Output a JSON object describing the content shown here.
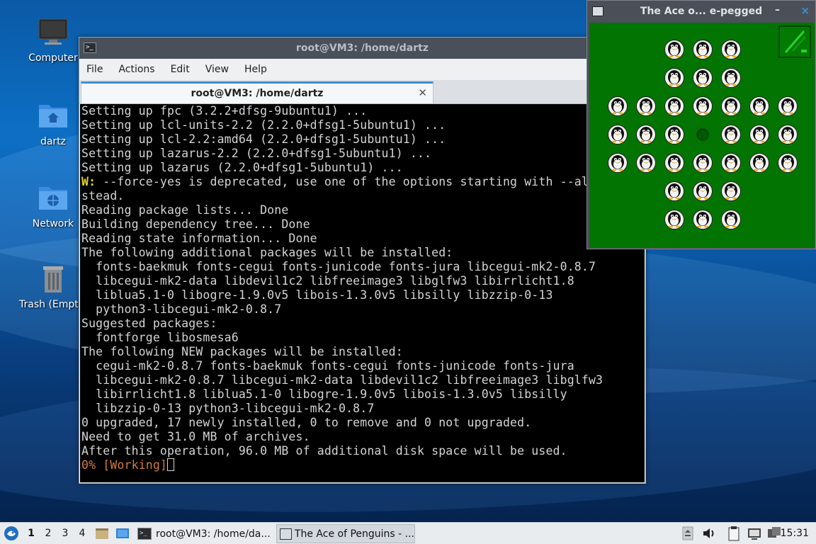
{
  "desktop": {
    "icons": [
      {
        "label": "Computer"
      },
      {
        "label": "dartz"
      },
      {
        "label": "Network"
      },
      {
        "label": "Trash (Empty)"
      }
    ]
  },
  "terminal": {
    "window_title": "root@VM3: /home/dartz",
    "menu": [
      "File",
      "Actions",
      "Edit",
      "View",
      "Help"
    ],
    "tab_title": "root@VM3: /home/dartz",
    "lines": [
      "Setting up fpc (3.2.2+dfsg-9ubuntu1) ...",
      "Setting up lcl-units-2.2 (2.2.0+dfsg1-5ubuntu1) ...",
      "Setting up lcl-2.2:amd64 (2.2.0+dfsg1-5ubuntu1) ...",
      "Setting up lazarus-2.2 (2.2.0+dfsg1-5ubuntu1) ...",
      "Setting up lazarus (2.2.0+dfsg1-5ubuntu1) ..."
    ],
    "warn_prefix": "W:",
    "warn_text": " --force-yes is deprecated, use one of the options starting with --all",
    "lines2": [
      "stead.",
      "Reading package lists... Done",
      "Building dependency tree... Done",
      "Reading state information... Done",
      "The following additional packages will be installed:",
      "  fonts-baekmuk fonts-cegui fonts-junicode fonts-jura libcegui-mk2-0.8.7",
      "  libcegui-mk2-data libdevil1c2 libfreeimage3 libglfw3 libirrlicht1.8",
      "  liblua5.1-0 libogre-1.9.0v5 libois-1.3.0v5 libsilly libzzip-0-13",
      "  python3-libcegui-mk2-0.8.7",
      "Suggested packages:",
      "  fontforge libosmesa6",
      "The following NEW packages will be installed:",
      "  cegui-mk2-0.8.7 fonts-baekmuk fonts-cegui fonts-junicode fonts-jura",
      "  libcegui-mk2-0.8.7 libcegui-mk2-data libdevil1c2 libfreeimage3 libglfw3",
      "  libirrlicht1.8 liblua5.1-0 libogre-1.9.0v5 libois-1.3.0v5 libsilly",
      "  libzzip-0-13 python3-libcegui-mk2-0.8.7",
      "0 upgraded, 17 newly installed, 0 to remove and 0 not upgraded.",
      "Need to get 31.0 MB of archives.",
      "After this operation, 96.0 MB of additional disk space will be used."
    ],
    "progress_line": "0% [Working]"
  },
  "ace_window": {
    "title": "The Ace o... e-pegged",
    "min_glyph": "–",
    "close_glyph": "×"
  },
  "taskbar": {
    "workspaces": [
      "1",
      "2",
      "3",
      "4"
    ],
    "tasks": [
      {
        "label": "root@VM3: /home/da..."
      },
      {
        "label": "The Ace of Penguins - ..."
      }
    ],
    "clock": "15:31"
  }
}
